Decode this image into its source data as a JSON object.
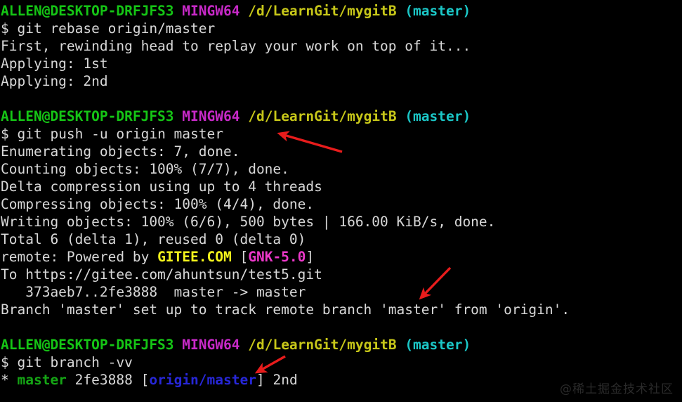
{
  "terminal": {
    "background_color": "#000000",
    "foreground_color": "#d8d8d8",
    "colors": {
      "green": "#15c515",
      "magenta": "#c829c8",
      "yellow": "#c7c719",
      "cyan": "#1bc7c7",
      "bright_yellow": "#f5f51c",
      "pink": "#ec38c9",
      "blue": "#2727d8",
      "arrow_red": "#e81c1c"
    },
    "prompt": {
      "user_host": "ALLEN@DESKTOP-DRFJFS3",
      "shell": "MINGW64",
      "path": "/d/LearnGit/mygitB",
      "branch": "(master)",
      "symbol": "$ "
    },
    "lines": {
      "l01_cmd": "git rebase origin/master",
      "l02": "First, rewinding head to replay your work on top of it...",
      "l03": "Applying: 1st",
      "l04": "Applying: 2nd",
      "l05_cmd": "git push -u origin master",
      "l06": "Enumerating objects: 7, done.",
      "l07": "Counting objects: 100% (7/7), done.",
      "l08": "Delta compression using up to 4 threads",
      "l09": "Compressing objects: 100% (4/4), done.",
      "l10": "Writing objects: 100% (6/6), 500 bytes | 166.00 KiB/s, done.",
      "l11": "Total 6 (delta 1), reused 0 (delta 0)",
      "l12_prefix": "remote: Powered by ",
      "l12_gitee": "GITEE.COM",
      "l12_bracket_open": " [",
      "l12_gnk": "GNK-5.0",
      "l12_bracket_close": "]",
      "l13": "To https://gitee.com/ahuntsun/test5.git",
      "l14": "   373aeb7..2fe3888  master -> master",
      "l15": "Branch 'master' set up to track remote branch 'master' from 'origin'.",
      "l16_cmd": "git branch -vv",
      "l17_star": "* ",
      "l17_branch": "master",
      "l17_hash": " 2fe3888 ",
      "l17_bracket_open": "[",
      "l17_upstream": "origin/master",
      "l17_bracket_close": "]",
      "l17_msg": " 2nd"
    }
  },
  "watermark": {
    "text": "@稀土掘金技术社区"
  },
  "annotations": {
    "arrow1": {
      "label": "arrow-pointing-to-git-push-command"
    },
    "arrow2": {
      "label": "arrow-pointing-to-branch-tracking-message"
    },
    "arrow3": {
      "label": "arrow-pointing-to-origin-master-upstream"
    }
  }
}
